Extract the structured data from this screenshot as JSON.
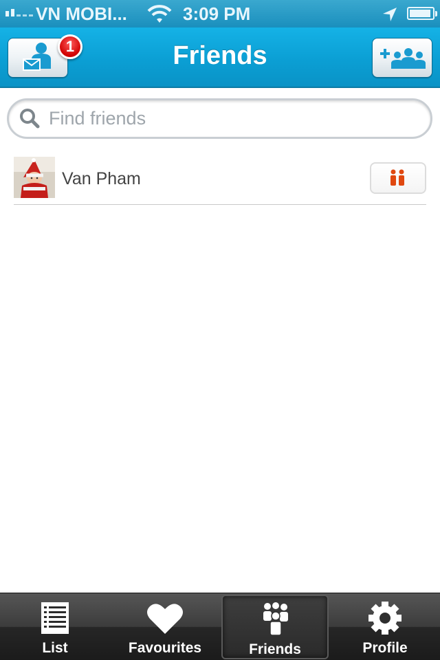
{
  "status_bar": {
    "carrier": "VN MOBI...",
    "time": "3:09 PM"
  },
  "nav": {
    "title": "Friends",
    "left_button_icon": "friend-requests-icon",
    "badge_count": "1",
    "right_button_icon": "add-friends-icon"
  },
  "search": {
    "placeholder": "Find friends",
    "value": ""
  },
  "friends": [
    {
      "name": "Van Pham",
      "avatar_icon": "avatar-photo",
      "action_icon": "friend-status-icon"
    }
  ],
  "tabs": [
    {
      "label": "List",
      "icon": "list-icon",
      "active": false
    },
    {
      "label": "Favourites",
      "icon": "heart-icon",
      "active": false
    },
    {
      "label": "Friends",
      "icon": "friends-icon",
      "active": true
    },
    {
      "label": "Profile",
      "icon": "gear-icon",
      "active": false
    }
  ],
  "colors": {
    "nav_blue": "#0b9fd4",
    "badge_red": "#d00000",
    "action_orange": "#e04810",
    "icon_blue": "#1a9bd0"
  }
}
